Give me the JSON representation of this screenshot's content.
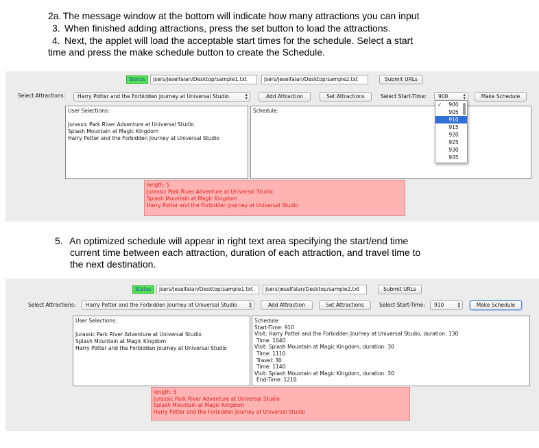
{
  "instructions_top": [
    {
      "num": "2a.",
      "lines": [
        "The message window at the bottom will indicate how many attractions you can input"
      ]
    },
    {
      "num": "3.",
      "lines": [
        "When finished adding attractions, press the set button to load the attractions."
      ]
    },
    {
      "num": "4.",
      "lines": [
        "Next, the applet will load the acceptable start times for the schedule. Select a start",
        "time and press the make schedule button to create the Schedule."
      ]
    }
  ],
  "instructions_mid": {
    "num": "5.",
    "lines": [
      "An optimized schedule will appear in right text area specifying the start/end time",
      "current time between each attraction, duration of each attraction, and travel time to",
      "the next destination."
    ]
  },
  "panel1": {
    "status": "Status",
    "url1": "Jsers/jeselfalan/Desktop/sample1.txt",
    "url2": "Jsers/jeselfalan/Desktop/sample2.txt",
    "submit": "Submit URLs",
    "select_label": "Select Attractions:",
    "attraction_value": "Harry Potter and the Forbidden Journey at Universal Studio",
    "add": "Add Attraction",
    "set": "Set Attractions",
    "start_label": "Select Start-Time:",
    "start_value": "900",
    "make": "Make Schedule",
    "user_title": "User Selections:",
    "user_lines": [
      "Jurassic Park River Adventure at Universal Studio",
      "Splash Mountain at Magic Kingdom",
      "Harry Potter and the Forbidden Journey at Universal Studio"
    ],
    "schedule_title": "Schedule:",
    "dropdown_options": [
      "900",
      "905",
      "910",
      "915",
      "920",
      "925",
      "930",
      "935"
    ],
    "dropdown_checked": "900",
    "dropdown_selected": "910",
    "msg_lines": [
      "length: 5",
      "Jurassic Park River Adventure at Universal Studio",
      "Splash Mountain at Magic Kingdom",
      "Harry Potter and the Forbidden Journey at Universal Studio"
    ]
  },
  "panel2": {
    "status": "Status",
    "url1": "Jsers/jeselfalan/Desktop/sample1.txt",
    "url2": "Jsers/jeselfalan/Desktop/sample2.txt",
    "submit": "Submit URLs",
    "select_label": "Select Attractions:",
    "attraction_value": "Harry Potter and the Forbidden Journey at Universal Studio",
    "add": "Add Attraction",
    "set": "Set Attractions",
    "start_label": "Select Start-Time:",
    "start_value": "910",
    "make": "Make Schedule",
    "user_title": "User Selections:",
    "user_lines": [
      "Jurassic Park River Adventure at Universal Studio",
      "Splash Mountain at Magic Kingdom",
      "Harry Potter and the Forbidden Journey at Universal Studio"
    ],
    "schedule_lines": [
      "Schedule:",
      "Start-Time: 910",
      "Visit: Harry Potter and the Forbidden Journey at Universal Studio, duration: 130",
      " Time: 1040",
      "Visit: Splash Mountain at Magic Kingdom, duration: 30",
      " Time: 1110",
      " Travel: 30",
      " Time: 1140",
      "Visit: Splash Mountain at Magic Kingdom, duration: 30",
      " End-Time: 1210"
    ],
    "msg_lines": [
      "length: 5",
      "Jurassic Park River Adventure at Universal Studio",
      "Splash Mountain at Magic Kingdom",
      "Harry Potter and the Forbidden Journey at Universal Studio"
    ]
  },
  "colors": {
    "panel_bg": "#ececec",
    "status_green": "#55e055",
    "message_bg": "#ffb3b3",
    "message_text": "#e02020",
    "selection_blue": "#2f6fd6"
  }
}
